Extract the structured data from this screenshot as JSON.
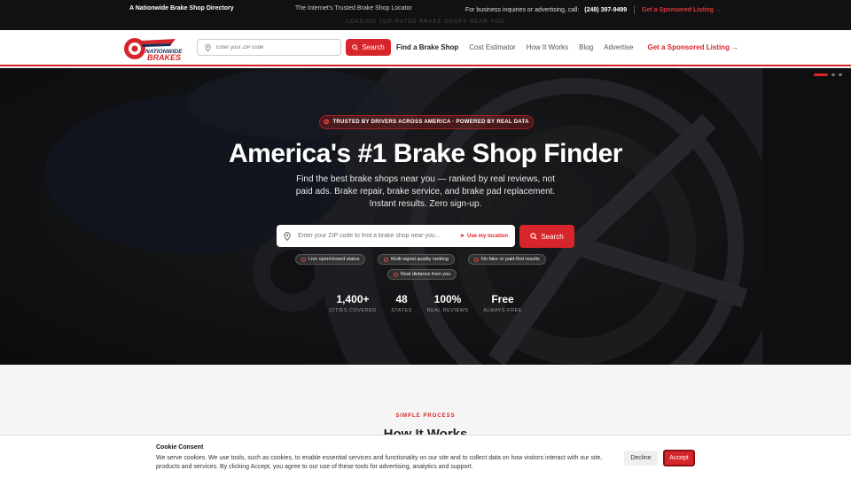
{
  "topbar": {
    "left": "A Nationwide Brake Shop Directory",
    "middle": "The Internet's Trusted Brake Shop Locator",
    "contact_label": "For business inquiries or advertising, call:",
    "phone": "(248) 397-9499",
    "sponsored": "Get a Sponsored Listing →",
    "loading": "LOADING TOP-RATED BRAKE SHOPS NEAR YOU"
  },
  "nav": {
    "logo_text_top": "NATIONWIDE",
    "logo_text_bottom": "BRAKES",
    "search_placeholder": "Enter your ZIP code",
    "search_button": "Search",
    "links": [
      "Find a Brake Shop",
      "Cost Estimator",
      "How It Works",
      "Blog",
      "Advertise"
    ],
    "sponsored": "Get a Sponsored Listing →"
  },
  "hero": {
    "badge": "TRUSTED BY DRIVERS ACROSS AMERICA · POWERED BY REAL DATA",
    "title": "America's #1 Brake Shop Finder",
    "subtitle": "Find the best brake shops near you — ranked by real reviews, not paid ads. Brake repair, brake service, and brake pad replacement. Instant results. Zero sign-up.",
    "search_placeholder": "Enter your ZIP code to find a brake shop near you...",
    "use_location": "Use my location",
    "search_button": "Search",
    "pills": [
      "Live open/closed status",
      "Multi-signal quality ranking",
      "No fake or paid-first results",
      "Real distance from you"
    ],
    "stats": [
      {
        "value": "1,400+",
        "label": "CITIES COVERED"
      },
      {
        "value": "48",
        "label": "STATES"
      },
      {
        "value": "100%",
        "label": "REAL REVIEWS"
      },
      {
        "value": "Free",
        "label": "ALWAYS FREE"
      }
    ]
  },
  "section": {
    "eyebrow": "SIMPLE PROCESS",
    "title": "How It Works"
  },
  "cookie": {
    "title": "Cookie Consent",
    "body": "We serve cookies. We use tools, such as cookies, to enable essential services and functionality on our site and to collect data on how visitors interact with our site, products and services. By clicking Accept, you agree to our use of these tools for advertising, analytics and support.",
    "decline": "Decline",
    "accept": "Accept"
  },
  "colors": {
    "brand_red": "#d7262b",
    "topbar_bg": "#111114"
  }
}
